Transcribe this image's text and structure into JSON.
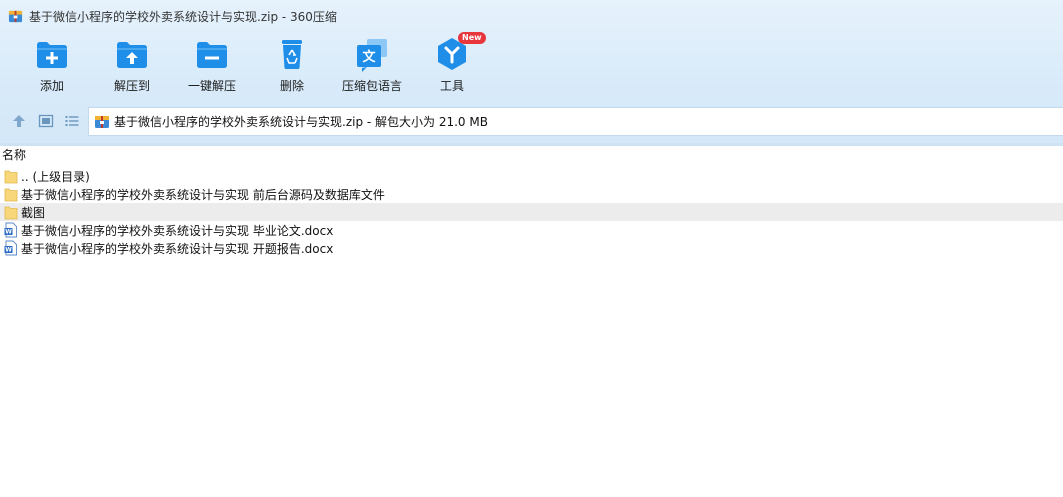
{
  "window": {
    "title": "基于微信小程序的学校外卖系统设计与实现.zip - 360压缩",
    "app_icon": "archive-icon"
  },
  "toolbar": {
    "items": [
      {
        "label": "添加",
        "icon": "add-folder-icon"
      },
      {
        "label": "解压到",
        "icon": "extract-to-icon"
      },
      {
        "label": "一键解压",
        "icon": "one-click-extract-icon"
      },
      {
        "label": "删除",
        "icon": "recycle-bin-icon"
      },
      {
        "label": "压缩包语言",
        "icon": "language-icon"
      },
      {
        "label": "工具",
        "icon": "tools-icon",
        "badge": "New"
      }
    ]
  },
  "nav": {
    "address": "基于微信小程序的学校外卖系统设计与实现.zip - 解包大小为 21.0 MB"
  },
  "list": {
    "column_name": "名称",
    "items": [
      {
        "name": ".. (上级目录)",
        "type": "folder"
      },
      {
        "name": "基于微信小程序的学校外卖系统设计与实现 前后台源码及数据库文件",
        "type": "folder"
      },
      {
        "name": "截图",
        "type": "folder",
        "selected": true
      },
      {
        "name": "基于微信小程序的学校外卖系统设计与实现 毕业论文.docx",
        "type": "docx"
      },
      {
        "name": "基于微信小程序的学校外卖系统设计与实现 开题报告.docx",
        "type": "docx"
      }
    ]
  },
  "colors": {
    "accent": "#1e8ee8",
    "badge": "#e8363d",
    "folder": "#f7d77a",
    "selection": "#ececec"
  }
}
